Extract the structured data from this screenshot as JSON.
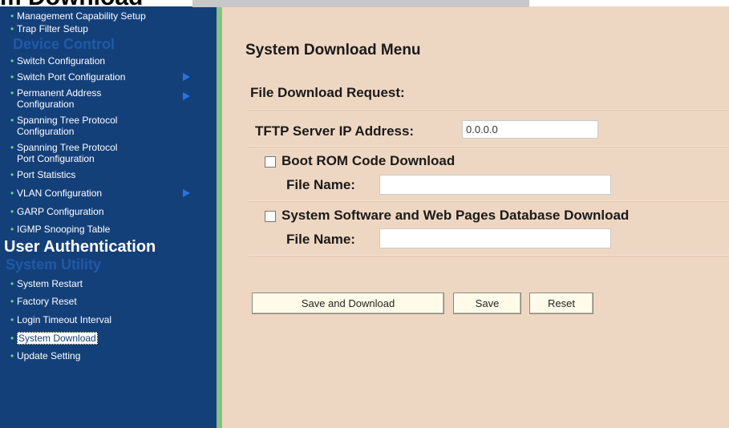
{
  "page_title": "m Download",
  "sidebar": {
    "items_top": [
      {
        "label": "Management Capability Setup"
      },
      {
        "label": "Trap Filter Setup"
      }
    ],
    "section_device_control": "Device Control",
    "device_items": [
      {
        "label": "Switch Configuration"
      },
      {
        "label": "Switch Port Configuration"
      },
      {
        "line1": "Permanent Address",
        "line2": "Configuration"
      },
      {
        "line1": "Spanning Tree Protocol",
        "line2": "Configuration"
      },
      {
        "line1": "Spanning Tree Protocol",
        "line2": "Port Configuration"
      },
      {
        "label": "Port Statistics"
      },
      {
        "label": "VLAN Configuration"
      },
      {
        "label": "GARP Configuration"
      },
      {
        "label": "IGMP Snooping Table"
      }
    ],
    "section_user_auth": "User Authentication",
    "section_system_utility": "System Utility",
    "utility_items": [
      {
        "label": "System Restart"
      },
      {
        "label": "Factory Reset"
      },
      {
        "label": "Login Timeout Interval"
      },
      {
        "label": "System Download"
      },
      {
        "label": "Update Setting"
      }
    ]
  },
  "main": {
    "heading": "System Download Menu",
    "subheading": "File Download Request:",
    "tftp_label": "TFTP Server IP Address:",
    "tftp_value": "0.0.0.0",
    "boot_rom_label": "Boot ROM Code Download",
    "file_name_label_1": "File Name:",
    "file_name_value_1": "",
    "system_sw_label": "System Software and Web Pages Database Download",
    "file_name_label_2": "File Name:",
    "file_name_value_2": ""
  },
  "buttons": {
    "save_download": "Save and Download",
    "save": "Save",
    "reset": "Reset"
  },
  "colors": {
    "sidebar_bg": "#14407a",
    "main_bg": "#eed7c2",
    "divider_green": "#8dbf7c"
  }
}
